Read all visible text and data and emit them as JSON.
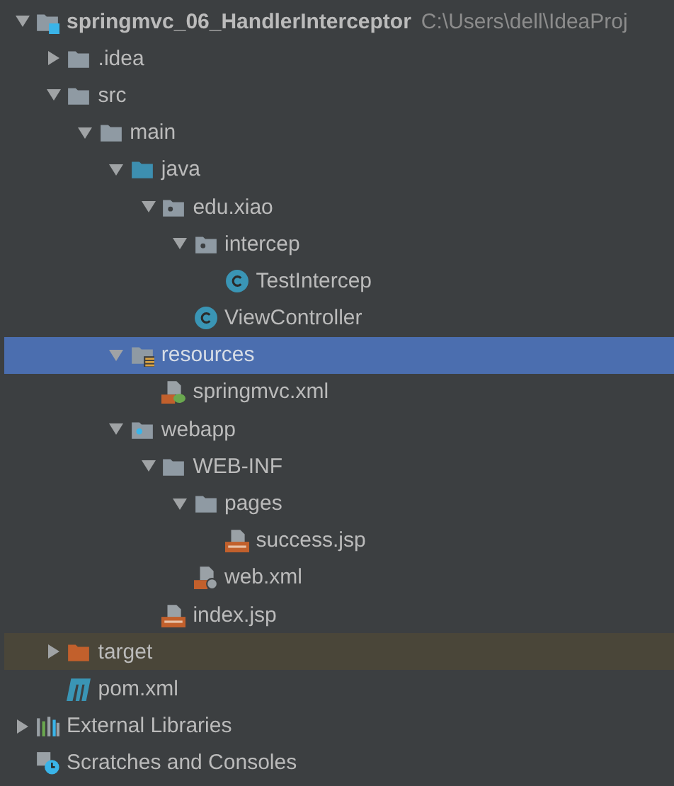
{
  "project_tree": [
    {
      "label": "springmvc_06_HandlerInterceptor",
      "path": "C:\\Users\\dell\\IdeaProj",
      "kind": "module",
      "expanded": true,
      "selected": false,
      "children": [
        {
          "label": ".idea",
          "kind": "folder",
          "expanded": false,
          "selected": false
        },
        {
          "label": "src",
          "kind": "folder",
          "expanded": true,
          "selected": false,
          "children": [
            {
              "label": "main",
              "kind": "folder",
              "expanded": true,
              "selected": false,
              "children": [
                {
                  "label": "java",
                  "kind": "source-folder",
                  "expanded": true,
                  "selected": false,
                  "children": [
                    {
                      "label": "edu.xiao",
                      "kind": "package",
                      "expanded": true,
                      "selected": false,
                      "children": [
                        {
                          "label": "intercep",
                          "kind": "package",
                          "expanded": true,
                          "selected": false,
                          "children": [
                            {
                              "label": "TestIntercep",
                              "kind": "class",
                              "selected": false
                            }
                          ]
                        },
                        {
                          "label": "ViewController",
                          "kind": "class",
                          "selected": false
                        }
                      ]
                    }
                  ]
                },
                {
                  "label": "resources",
                  "kind": "resources-folder",
                  "expanded": true,
                  "selected": true,
                  "children": [
                    {
                      "label": "springmvc.xml",
                      "kind": "spring-xml",
                      "selected": false
                    }
                  ]
                },
                {
                  "label": "webapp",
                  "kind": "web-folder",
                  "expanded": true,
                  "selected": false,
                  "children": [
                    {
                      "label": "WEB-INF",
                      "kind": "folder",
                      "expanded": true,
                      "selected": false,
                      "children": [
                        {
                          "label": "pages",
                          "kind": "folder",
                          "expanded": true,
                          "selected": false,
                          "children": [
                            {
                              "label": "success.jsp",
                              "kind": "jsp",
                              "selected": false
                            }
                          ]
                        },
                        {
                          "label": "web.xml",
                          "kind": "web-xml",
                          "selected": false
                        }
                      ]
                    },
                    {
                      "label": "index.jsp",
                      "kind": "jsp",
                      "selected": false
                    }
                  ]
                }
              ]
            }
          ]
        },
        {
          "label": "target",
          "kind": "excluded-folder",
          "expanded": false,
          "selected": false
        },
        {
          "label": "pom.xml",
          "kind": "maven",
          "selected": false
        }
      ]
    },
    {
      "label": "External Libraries",
      "kind": "libraries",
      "expanded": false,
      "selected": false
    },
    {
      "label": "Scratches and Consoles",
      "kind": "scratches",
      "selected": false
    }
  ]
}
